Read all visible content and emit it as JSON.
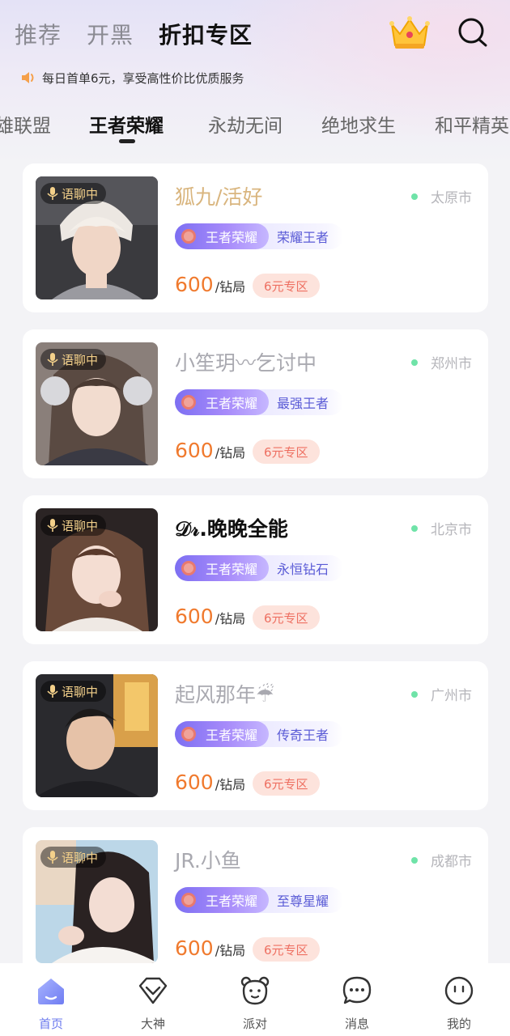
{
  "header": {
    "tabs": [
      {
        "label": "推荐",
        "active": false
      },
      {
        "label": "开黑",
        "active": false
      },
      {
        "label": "折扣专区",
        "active": true
      }
    ],
    "icons": [
      "crown-icon",
      "search-icon"
    ]
  },
  "notice": {
    "icon": "speaker-icon",
    "text": "每日首单6元，享受高性价比优质服务"
  },
  "game_tabs": [
    {
      "label": "雄联盟",
      "active": false
    },
    {
      "label": "王者荣耀",
      "active": true
    },
    {
      "label": "永劫无间",
      "active": false
    },
    {
      "label": "绝地求生",
      "active": false
    },
    {
      "label": "和平精英",
      "active": false
    }
  ],
  "players": [
    {
      "name": "狐九/活好",
      "name_color": "#d9b57e",
      "city": "太原市",
      "status": "语聊中",
      "game": "王者荣耀",
      "rank": "荣耀王者",
      "price": "600",
      "unit": "/钻局",
      "promo": "6元专区"
    },
    {
      "name": "小笙玥〰乞讨中",
      "name_color": "#a9a9b0",
      "city": "郑州市",
      "status": "语聊中",
      "game": "王者荣耀",
      "rank": "最强王者",
      "price": "600",
      "unit": "/钻局",
      "promo": "6元专区"
    },
    {
      "name": "𝒟𝓇.晚晚全能",
      "name_color": "#111111",
      "city": "北京市",
      "status": "语聊中",
      "game": "王者荣耀",
      "rank": "永恒钻石",
      "price": "600",
      "unit": "/钻局",
      "promo": "6元专区"
    },
    {
      "name": "起风那年☔",
      "name_color": "#a9a9b0",
      "city": "广州市",
      "status": "语聊中",
      "game": "王者荣耀",
      "rank": "传奇王者",
      "price": "600",
      "unit": "/钻局",
      "promo": "6元专区"
    },
    {
      "name": "JR.小鱼",
      "name_color": "#a9a9b0",
      "city": "成都市",
      "status": "语聊中",
      "game": "王者荣耀",
      "rank": "至尊星耀",
      "price": "600",
      "unit": "/钻局",
      "promo": "6元专区"
    }
  ],
  "bottom_nav": [
    {
      "label": "首页",
      "icon": "home-icon",
      "active": true
    },
    {
      "label": "大神",
      "icon": "diamond-icon",
      "active": false
    },
    {
      "label": "派对",
      "icon": "bear-icon",
      "active": false
    },
    {
      "label": "消息",
      "icon": "chat-bubble-icon",
      "active": false
    },
    {
      "label": "我的",
      "icon": "profile-face-icon",
      "active": false
    }
  ],
  "colors": {
    "accent": "#6b79ee",
    "price": "#f07a2e",
    "promo_bg": "#fde3dc",
    "online_dot": "#6fe3a8"
  }
}
